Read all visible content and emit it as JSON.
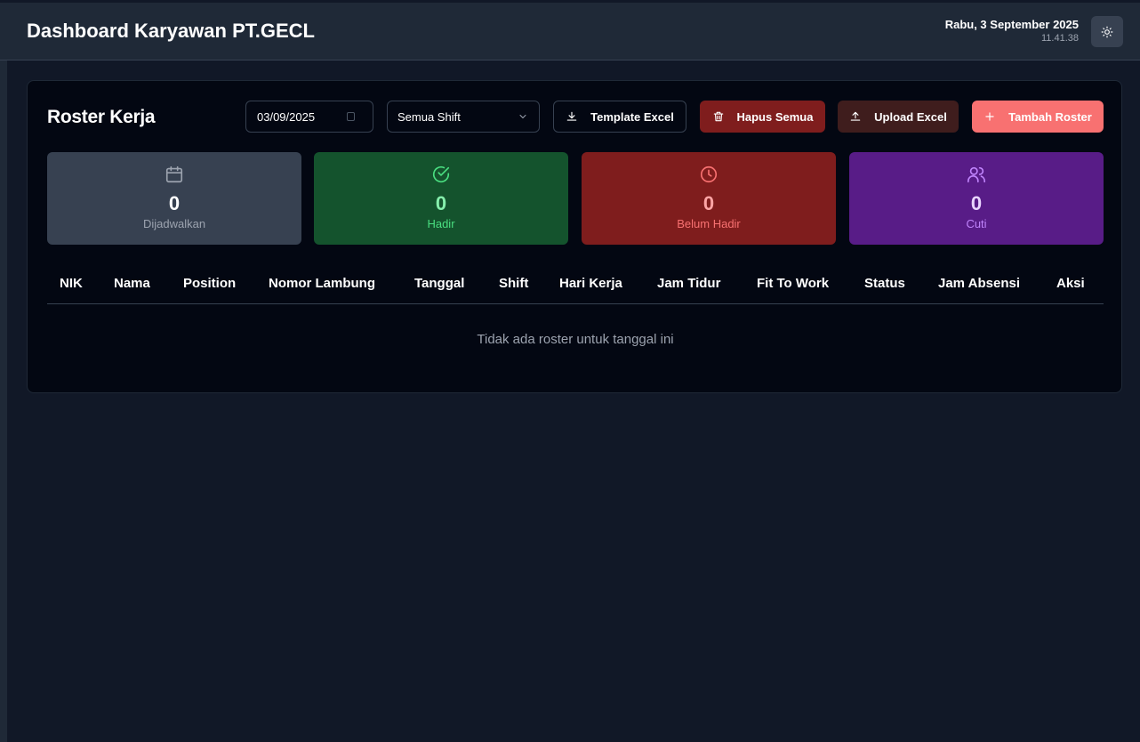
{
  "app": {
    "title": "Dashboard Karyawan PT.GECL"
  },
  "header": {
    "date": "Rabu, 3 September 2025",
    "time": "11.41.38",
    "theme_icon": "sun-icon"
  },
  "colors": {
    "accent": "#dc2626",
    "primary_button": "#f87171",
    "danger_button": "#7f1d1d"
  },
  "roster": {
    "title": "Roster Kerja",
    "date_value": "03/09/2025",
    "shift_selected": "Semua Shift",
    "buttons": {
      "template": "Template Excel",
      "hapus": "Hapus Semua",
      "upload": "Upload Excel",
      "tambah": "Tambah Roster"
    },
    "stats": [
      {
        "value": "0",
        "label": "Dijadwalkan",
        "icon": "calendar-icon"
      },
      {
        "value": "0",
        "label": "Hadir",
        "icon": "check-circle-icon"
      },
      {
        "value": "0",
        "label": "Belum Hadir",
        "icon": "clock-icon"
      },
      {
        "value": "0",
        "label": "Cuti",
        "icon": "users-icon"
      }
    ],
    "columns": [
      "NIK",
      "Nama",
      "Position",
      "Nomor Lambung",
      "Tanggal",
      "Shift",
      "Hari Kerja",
      "Jam Tidur",
      "Fit To Work",
      "Status",
      "Jam Absensi",
      "Aksi"
    ],
    "empty_message": "Tidak ada roster untuk tanggal ini"
  }
}
